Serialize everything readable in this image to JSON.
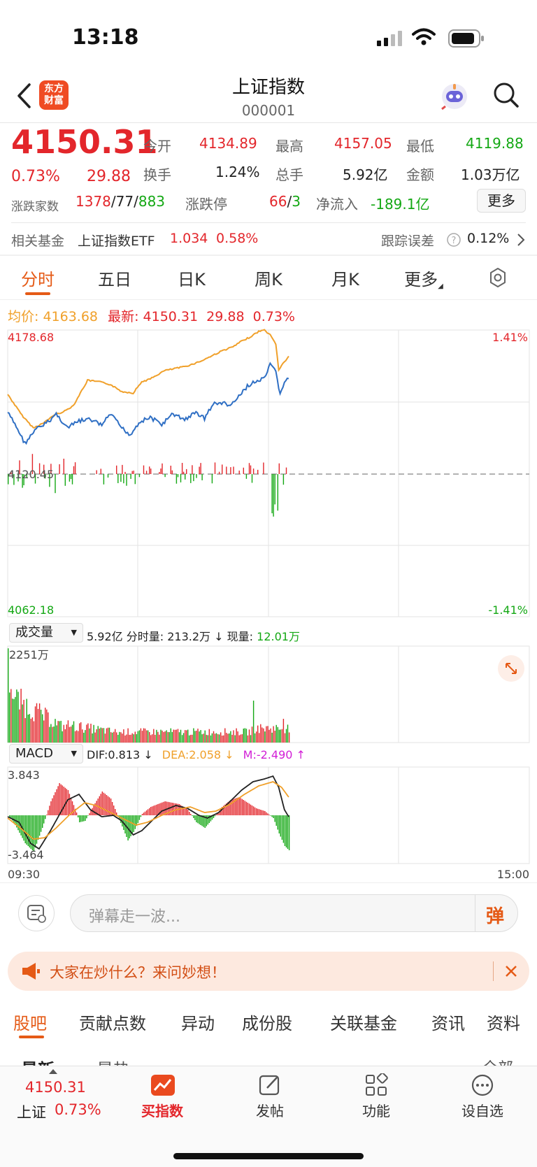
{
  "status_bar": {
    "time": "13:18"
  },
  "nav": {
    "title": "上证指数",
    "code": "000001",
    "logo_text_1": "东方",
    "logo_text_2": "财富"
  },
  "quote": {
    "price": "4150.31",
    "change_pct": "0.73%",
    "change": "29.88",
    "open_label": "今开",
    "open": "4134.89",
    "high_label": "最高",
    "high": "4157.05",
    "low_label": "最低",
    "low": "4119.88",
    "turnover_label": "换手",
    "turnover": "1.24%",
    "volume_label": "总手",
    "volume": "5.92亿",
    "amount_label": "金额",
    "amount": "1.03万亿",
    "breadth_label": "涨跌家数",
    "breadth_up": "1378",
    "breadth_flat": "77",
    "breadth_down": "883",
    "limit_label": "涨跌停",
    "limit_up": "66",
    "limit_down": "3",
    "netflow_label": "净流入",
    "netflow": "-189.1亿",
    "more_button": "更多",
    "sep": "/"
  },
  "fund_row": {
    "label": "相关基金",
    "name": "上证指数ETF",
    "price": "1.034",
    "pct": "0.58%",
    "tracking_label": "跟踪误差",
    "tracking_value": "0.12%"
  },
  "kline_tabs": [
    "分时",
    "五日",
    "日K",
    "周K",
    "月K",
    "更多"
  ],
  "intraday": {
    "avg_label": "均价:",
    "avg_value": "4163.68",
    "latest_label": "最新:",
    "latest_value": "4150.31",
    "latest_change": "29.88",
    "latest_pct": "0.73%",
    "y_top": "4178.68",
    "y_mid": "4120.45",
    "y_bottom": "4062.18",
    "pct_top": "1.41%",
    "pct_bottom": "-1.41%"
  },
  "volume_panel": {
    "selector": "成交量",
    "total": "5.92亿",
    "period_label": "分时量:",
    "period_value": "213.2万 ↓",
    "now_label": "现量:",
    "now_value": "12.01万",
    "max_label": "2251万"
  },
  "macd_panel": {
    "selector": "MACD",
    "dif": "DIF:0.813 ↓",
    "dea": "DEA:2.058 ↓",
    "m": "M:-2.490 ↑",
    "y_top": "3.843",
    "y_bottom": "-3.464",
    "time_start": "09:30",
    "time_end": "15:00"
  },
  "comment_bar": {
    "placeholder": "弹幕走一波...",
    "danmaku_button": "弹"
  },
  "banner": {
    "text": "大家在炒什么？来问妙想！"
  },
  "section_tabs": [
    "股吧",
    "贡献点数",
    "异动",
    "成份股",
    "关联基金",
    "资讯",
    "资料"
  ],
  "sub_tabs_partial": [
    "最新",
    "最热",
    "全部"
  ],
  "bottom_nav": {
    "quote_price": "4150.31",
    "quote_name": "上证",
    "quote_pct": "0.73%",
    "buy_label": "买指数",
    "post_label": "发帖",
    "function_label": "功能",
    "watchlist_label": "设自选"
  },
  "colors": {
    "up": "#e3262b",
    "down": "#14a814",
    "accent": "#e55a16",
    "avg_line": "#f0a02a",
    "price_line": "#2f6fc4",
    "dif_line": "#222222",
    "dea_line": "#f0a02a"
  }
}
